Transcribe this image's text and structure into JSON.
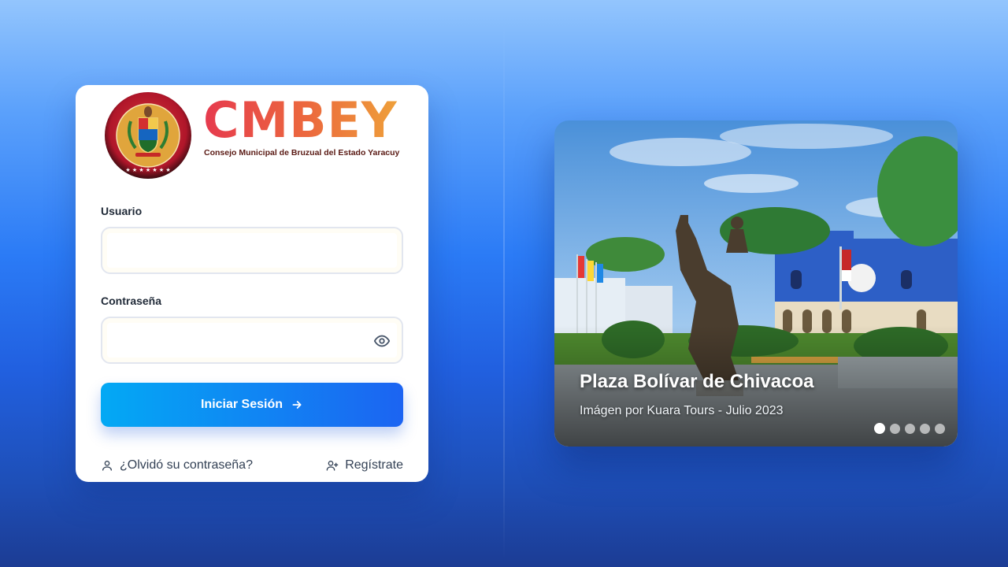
{
  "logo": {
    "seal_text": "CONCEJO MUNICIPAL DE BRUZUAL DEL EDO. YARACUY",
    "title": "CMBEY",
    "subtitle": "Consejo Municipal de Bruzual del Estado Yaracuy"
  },
  "form": {
    "username_label": "Usuario",
    "username_value": "",
    "password_label": "Contraseña",
    "password_value": "",
    "login_button": "Iniciar Sesión",
    "forgot_link": "¿Olvidó su contraseña?",
    "register_link": "Regístrate"
  },
  "carousel": {
    "title": "Plaza Bolívar de Chivacoa",
    "credit": "Imágen por Kuara Tours - Julio 2023",
    "slide_count": 5,
    "active_index": 0
  },
  "colors": {
    "brand_gradient_start": "#03a9f4",
    "brand_gradient_end": "#1c64f2",
    "logo_red": "#e63a4e",
    "logo_orange": "#eea03a"
  },
  "icons": [
    "user-icon",
    "user-plus-icon",
    "eye-icon",
    "arrow-right-icon",
    "seal-logo"
  ]
}
